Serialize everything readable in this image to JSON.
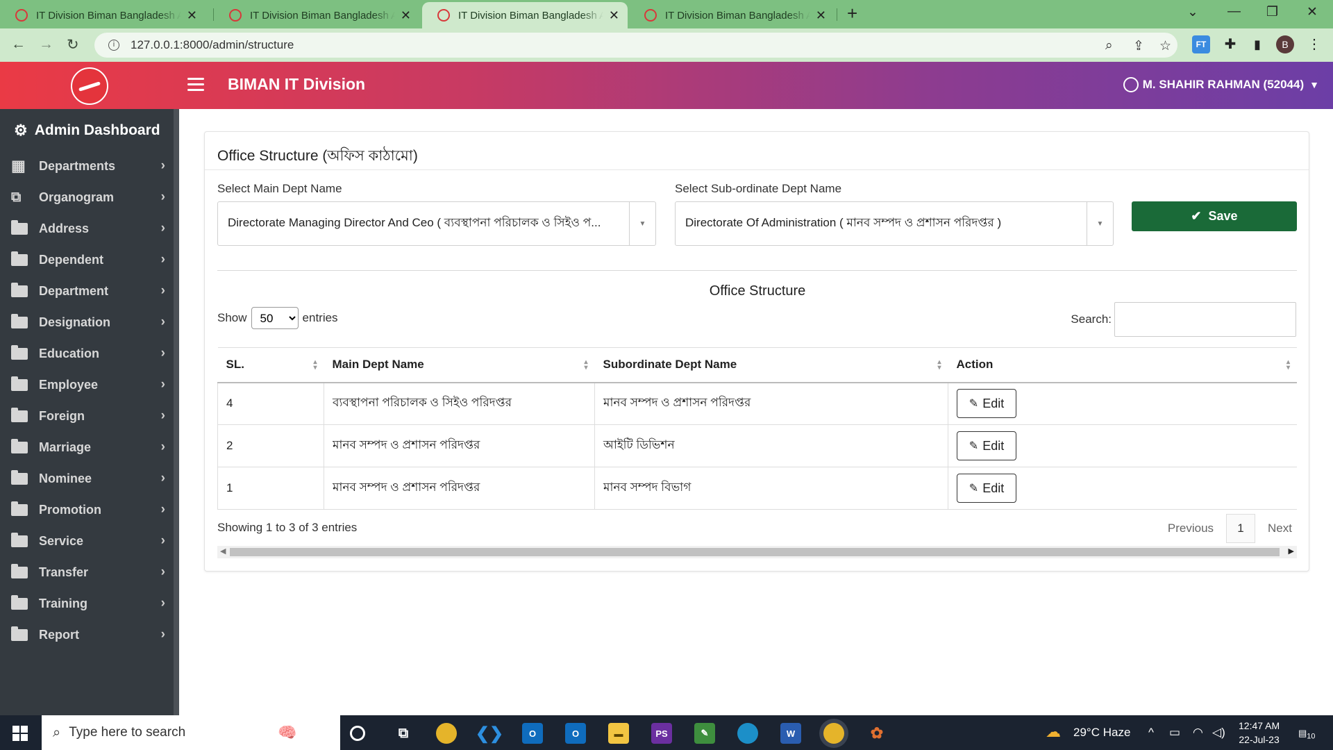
{
  "browser": {
    "tabs": [
      {
        "title": "IT Division Biman Bangladesh Airlines",
        "active": false
      },
      {
        "title": "IT Division Biman Bangladesh Airlines",
        "active": false
      },
      {
        "title": "IT Division Biman Bangladesh Airlines",
        "active": true
      },
      {
        "title": "IT Division Biman Bangladesh Airlines",
        "active": false
      }
    ],
    "url": "127.0.0.1:8000/admin/structure",
    "profile_initial": "B",
    "ext_label": "FT"
  },
  "header": {
    "brand": "BIMAN IT Division",
    "user": "M. SHAHIR RAHMAN (52044)"
  },
  "sidebar": {
    "title": "Admin Dashboard",
    "items": [
      {
        "label": "Departments"
      },
      {
        "label": "Organogram"
      },
      {
        "label": "Address"
      },
      {
        "label": "Dependent"
      },
      {
        "label": "Department"
      },
      {
        "label": "Designation"
      },
      {
        "label": "Education"
      },
      {
        "label": "Employee"
      },
      {
        "label": "Foreign"
      },
      {
        "label": "Marriage"
      },
      {
        "label": "Nominee"
      },
      {
        "label": "Promotion"
      },
      {
        "label": "Service"
      },
      {
        "label": "Transfer"
      },
      {
        "label": "Training"
      },
      {
        "label": "Report"
      }
    ]
  },
  "page": {
    "card_title": "Office Structure (অফিস কাঠামো)",
    "main_dept_label": "Select Main Dept Name",
    "main_dept_value": "Directorate Managing Director And Ceo ( ব্যবস্থাপনা পরিচালক ও সিইও প...",
    "sub_dept_label": "Select Sub-ordinate Dept Name",
    "sub_dept_value": "Directorate Of Administration ( মানব সম্পদ ও প্রশাসন পরিদপ্তর )",
    "save_label": "Save",
    "table_title": "Office Structure",
    "show_label": "Show",
    "entries_value": "50",
    "entries_label": "entries",
    "search_label": "Search:",
    "columns": [
      "SL.",
      "Main Dept Name",
      "Subordinate Dept Name",
      "Action"
    ],
    "rows": [
      {
        "sl": "4",
        "main": "ব্যবস্থাপনা পরিচালক ও সিইও পরিদপ্তর",
        "sub": "মানব সম্পদ ও প্রশাসন পরিদপ্তর",
        "action": "Edit"
      },
      {
        "sl": "2",
        "main": "মানব সম্পদ ও প্রশাসন পরিদপ্তর",
        "sub": "আইটি ডিভিশন",
        "action": "Edit"
      },
      {
        "sl": "1",
        "main": "মানব সম্পদ ও প্রশাসন পরিদপ্তর",
        "sub": "মানব সম্পদ বিভাগ",
        "action": "Edit"
      }
    ],
    "footer_info": "Showing 1 to 3 of 3 entries",
    "pager": {
      "prev": "Previous",
      "current": "1",
      "next": "Next"
    }
  },
  "taskbar": {
    "search_placeholder": "Type here to search",
    "weather": "29°C  Haze",
    "time": "12:47 AM",
    "date": "22-Jul-23",
    "notifications": "10"
  }
}
